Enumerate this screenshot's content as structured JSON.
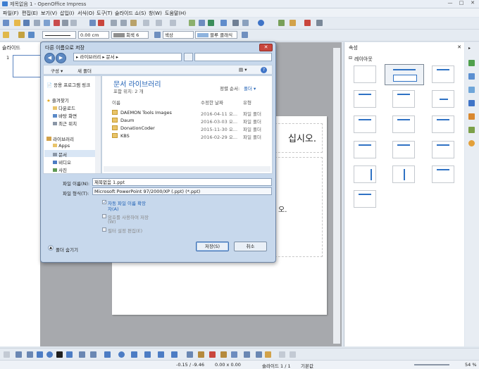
{
  "app": {
    "title": "제목없음 1 - OpenOffice Impress",
    "win_min": "—",
    "win_max": "□",
    "win_close": "✕"
  },
  "menu": [
    "파일(F)",
    "편집(E)",
    "보기(V)",
    "삽입(I)",
    "서식(O)",
    "도구(T)",
    "슬라이드 쇼(S)",
    "창(W)",
    "도움말(H)"
  ],
  "toolbar2": {
    "line_width": "0.00 cm",
    "line_color": "회색 6",
    "area_style": "색상",
    "area_color": "블루 클래식"
  },
  "panels": {
    "slides_title": "슬라이드",
    "slide_number": "1",
    "props_title": "속성",
    "layouts_title": "레이아웃"
  },
  "slide": {
    "title_fragment": "십시오.",
    "body_fragment": "오."
  },
  "dialog": {
    "title": "다른 이름으로 저장",
    "close": "✕",
    "back": "◀",
    "forward": "▶",
    "address_parts": [
      "라이브러리",
      "문서"
    ],
    "organize": "구성 ▾",
    "new_folder": "새 폴더",
    "help_icon": "?",
    "nav": {
      "quick_access": "응용 프로그램 링크",
      "favorites": "즐겨찾기",
      "fav_items": [
        "다운로드",
        "바탕 화면",
        "최근 위치"
      ],
      "libraries": "라이브러리",
      "lib_items": [
        "Apps",
        "문서",
        "비디오",
        "사진"
      ]
    },
    "library_title": "문서 라이브러리",
    "library_subtitle": "포함 위치: 2 개",
    "arrange_label": "정렬 순서:",
    "arrange_value": "폴더 ▾",
    "columns": [
      "이름",
      "수정한 날짜",
      "유형"
    ],
    "files": [
      {
        "name": "DAEMON Tools Images",
        "date": "2016-04-11 오...",
        "type": "파일 폴더"
      },
      {
        "name": "Daum",
        "date": "2016-03-03 오...",
        "type": "파일 폴더"
      },
      {
        "name": "DonationCoder",
        "date": "2015-11-30 오...",
        "type": "파일 폴더"
      },
      {
        "name": "KBS",
        "date": "2016-02-29 오...",
        "type": "파일 폴더"
      }
    ],
    "filename_label": "파일 이름(N):",
    "filename_value": "제목없음 1.ppt",
    "filetype_label": "파일 형식(T):",
    "filetype_value": "Microsoft PowerPoint 97/2000/XP (.ppt) (*.ppt)",
    "opt_auto_ext": "자동 파일 이름 확장",
    "opt_auto_ext2": "자(A)",
    "opt_password": "암호를 사용하여 저장",
    "opt_password2": "(W)",
    "opt_filter": "필터 설정 편집(E)",
    "hide_folders": "폴더 숨기기",
    "save_button": "저장(S)",
    "cancel_button": "취소"
  },
  "status": {
    "position": "-0.15 / -9.46",
    "size": "0.00 x 0.00",
    "slide_info": "슬라이드 1 / 1",
    "layout_name": "기본값",
    "zoom": "54 %"
  },
  "colors": {
    "accent": "#2f72c4",
    "dialog_bg": "#c7d8ec",
    "close_red": "#c9463d"
  }
}
